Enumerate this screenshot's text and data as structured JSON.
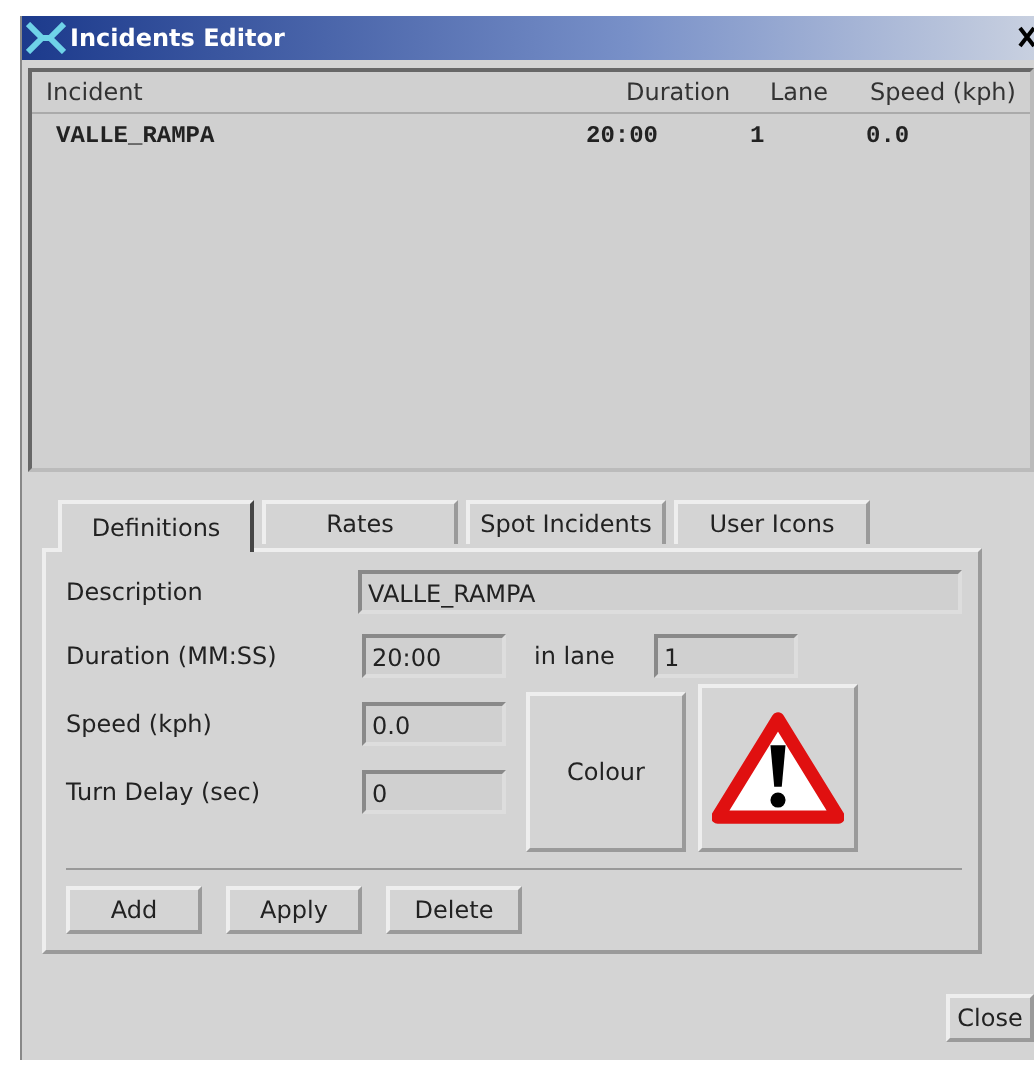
{
  "window": {
    "title": "Incidents Editor"
  },
  "table": {
    "columns": [
      "Incident",
      "Duration",
      "Lane",
      "Speed (kph)"
    ],
    "rows": [
      {
        "cells": [
          "VALLE_RAMPA",
          "20:00",
          "1",
          "0.0"
        ]
      }
    ]
  },
  "tabs": [
    {
      "label": "Definitions",
      "selected": true
    },
    {
      "label": "Rates",
      "selected": false
    },
    {
      "label": "Spot Incidents",
      "selected": false
    },
    {
      "label": "User Icons",
      "selected": false
    }
  ],
  "form": {
    "description": {
      "label": "Description",
      "value": "VALLE_RAMPA"
    },
    "duration": {
      "label": "Duration (MM:SS)",
      "value": "20:00"
    },
    "lane": {
      "label": "in lane",
      "value": "1"
    },
    "speed": {
      "label": "Speed (kph)",
      "value": "0.0"
    },
    "turn_delay": {
      "label": "Turn Delay (sec)",
      "value": "0"
    },
    "colour_button": "Colour"
  },
  "buttons": [
    "Add",
    "Apply",
    "Delete"
  ],
  "close_button": "Close"
}
